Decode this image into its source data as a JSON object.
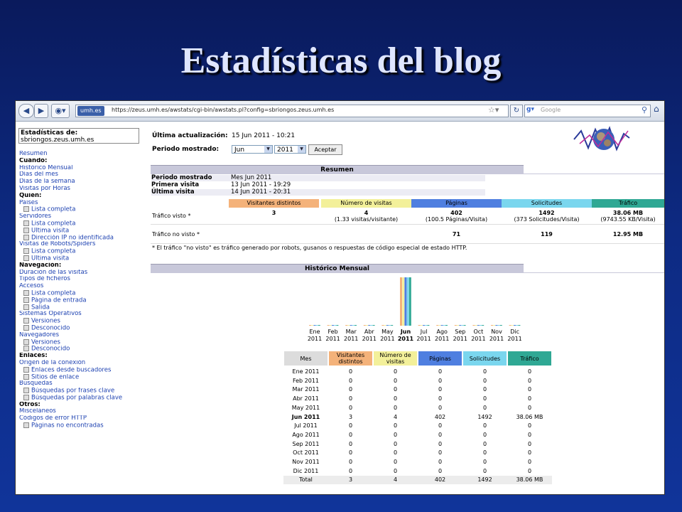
{
  "slide_title": "Estadísticas del blog",
  "browser": {
    "site_badge": "umh.es",
    "url": "https://zeus.umh.es/awstats/cgi-bin/awstats.pl?config=sbriongos.zeus.umh.es",
    "search_engine": "Google",
    "search_placeholder": "Google"
  },
  "sidebar": {
    "stats_label": "Estadísticas de:",
    "stats_site": "sbriongos.zeus.umh.es",
    "items": [
      {
        "type": "link",
        "label": "Resumen"
      },
      {
        "type": "head",
        "label": "Cuándo:"
      },
      {
        "type": "link",
        "label": "Histórico Mensual"
      },
      {
        "type": "link",
        "label": "Días del mes"
      },
      {
        "type": "link",
        "label": "Días de la semana"
      },
      {
        "type": "link",
        "label": "Visitas por Horas"
      },
      {
        "type": "head",
        "label": "Quién:"
      },
      {
        "type": "link",
        "label": "Países"
      },
      {
        "type": "sub",
        "label": "Lista completa"
      },
      {
        "type": "link",
        "label": "Servidores"
      },
      {
        "type": "sub",
        "label": "Lista completa"
      },
      {
        "type": "sub",
        "label": "Última visita"
      },
      {
        "type": "sub",
        "label": "Dirección IP no identificada"
      },
      {
        "type": "link",
        "label": "Visitas de Robots/Spiders"
      },
      {
        "type": "sub",
        "label": "Lista completa"
      },
      {
        "type": "sub",
        "label": "Última visita"
      },
      {
        "type": "head",
        "label": "Navegación:"
      },
      {
        "type": "link",
        "label": "Duración de las visitas"
      },
      {
        "type": "link",
        "label": "Tipos de ficheros"
      },
      {
        "type": "link",
        "label": "Accesos"
      },
      {
        "type": "sub",
        "label": "Lista completa"
      },
      {
        "type": "sub",
        "label": "Página de entrada"
      },
      {
        "type": "sub",
        "label": "Salida"
      },
      {
        "type": "link",
        "label": "Sistemas Operativos"
      },
      {
        "type": "sub",
        "label": "Versiones"
      },
      {
        "type": "sub",
        "label": "Desconocido"
      },
      {
        "type": "link",
        "label": "Navegadores"
      },
      {
        "type": "sub",
        "label": "Versiones"
      },
      {
        "type": "sub",
        "label": "Desconocido"
      },
      {
        "type": "head",
        "label": "Enlaces:"
      },
      {
        "type": "link",
        "label": "Origen de la conexión"
      },
      {
        "type": "sub",
        "label": "Enlaces desde buscadores"
      },
      {
        "type": "sub",
        "label": "Sitios de enlace"
      },
      {
        "type": "link",
        "label": "Búsquedas"
      },
      {
        "type": "sub",
        "label": "Búsquedas por frases clave"
      },
      {
        "type": "sub",
        "label": "Búsquedas por palabras clave"
      },
      {
        "type": "head",
        "label": "Otros:"
      },
      {
        "type": "link",
        "label": "Misceláneos"
      },
      {
        "type": "link",
        "label": "Códigos de error HTTP"
      },
      {
        "type": "sub",
        "label": "Páginas no encontradas"
      }
    ]
  },
  "header": {
    "last_update_label": "Última actualización:",
    "last_update_value": "15 Jun 2011 - 10:21",
    "period_label": "Periodo mostrado:",
    "month_select": "Jun",
    "year_select": "2011",
    "apply_label": "Aceptar"
  },
  "summary": {
    "title": "Resumen",
    "rows": [
      {
        "label": "Periodo mostrado",
        "value": "Mes Jun 2011"
      },
      {
        "label": "Primera visita",
        "value": "13 Jun 2011 - 19:29"
      },
      {
        "label": "Última visita",
        "value": "14 Jun 2011 - 20:31"
      }
    ],
    "columns": [
      "Visitantes distintos",
      "Número de visitas",
      "Páginas",
      "Solicitudes",
      "Tráfico"
    ],
    "column_colors": [
      "#f4b27a",
      "#f3f09a",
      "#4f7fe0",
      "#7ad6ee",
      "#2fa894"
    ],
    "seen_label": "Tráfico visto *",
    "seen": [
      [
        "3",
        ""
      ],
      [
        "4",
        "(1.33 visitas/visitante)"
      ],
      [
        "402",
        "(100.5 Páginas/Visita)"
      ],
      [
        "1492",
        "(373 Solicitudes/Visita)"
      ],
      [
        "38.06 MB",
        "(9743.55 KB/Visita)"
      ]
    ],
    "not_seen_label": "Tráfico no visto *",
    "not_seen": [
      "",
      "",
      "71",
      "119",
      "12.95 MB"
    ],
    "note": "* El tráfico \"no visto\" es tráfico generado por robots, gusanos o respuestas de código especial de estado HTTP."
  },
  "monthly": {
    "title": "Histórico Mensual",
    "headers": [
      "Mes",
      "Visitantes distintos",
      "Número de visitas",
      "Páginas",
      "Solicitudes",
      "Tráfico"
    ],
    "header_colors": [
      "#dcdcdc",
      "#f4b27a",
      "#f3f09a",
      "#4f7fe0",
      "#7ad6ee",
      "#2fa894"
    ],
    "rows": [
      [
        "Ene 2011",
        "0",
        "0",
        "0",
        "0",
        "0"
      ],
      [
        "Feb 2011",
        "0",
        "0",
        "0",
        "0",
        "0"
      ],
      [
        "Mar 2011",
        "0",
        "0",
        "0",
        "0",
        "0"
      ],
      [
        "Abr 2011",
        "0",
        "0",
        "0",
        "0",
        "0"
      ],
      [
        "May 2011",
        "0",
        "0",
        "0",
        "0",
        "0"
      ],
      [
        "Jun 2011",
        "3",
        "4",
        "402",
        "1492",
        "38.06 MB"
      ],
      [
        "Jul 2011",
        "0",
        "0",
        "0",
        "0",
        "0"
      ],
      [
        "Ago 2011",
        "0",
        "0",
        "0",
        "0",
        "0"
      ],
      [
        "Sep 2011",
        "0",
        "0",
        "0",
        "0",
        "0"
      ],
      [
        "Oct 2011",
        "0",
        "0",
        "0",
        "0",
        "0"
      ],
      [
        "Nov 2011",
        "0",
        "0",
        "0",
        "0",
        "0"
      ],
      [
        "Dic 2011",
        "0",
        "0",
        "0",
        "0",
        "0"
      ]
    ],
    "total": [
      "Total",
      "3",
      "4",
      "402",
      "1492",
      "38.06 MB"
    ]
  },
  "chart_data": {
    "type": "bar",
    "categories": [
      "Ene 2011",
      "Feb 2011",
      "Mar 2011",
      "Abr 2011",
      "May 2011",
      "Jun 2011",
      "Jul 2011",
      "Ago 2011",
      "Sep 2011",
      "Oct 2011",
      "Nov 2011",
      "Dic 2011"
    ],
    "cat_top": [
      "Ene",
      "Feb",
      "Mar",
      "Abr",
      "May",
      "Jun",
      "Jul",
      "Ago",
      "Sep",
      "Oct",
      "Nov",
      "Dic"
    ],
    "cat_bottom": [
      "2011",
      "2011",
      "2011",
      "2011",
      "2011",
      "2011",
      "2011",
      "2011",
      "2011",
      "2011",
      "2011",
      "2011"
    ],
    "highlight_index": 5,
    "series": [
      {
        "values": [
          0,
          0,
          0,
          0,
          0,
          3,
          0,
          0,
          0,
          0,
          0,
          0
        ],
        "color": "#f4b27a"
      },
      {
        "values": [
          0,
          0,
          0,
          0,
          0,
          4,
          0,
          0,
          0,
          0,
          0,
          0
        ],
        "color": "#f3f09a"
      },
      {
        "values": [
          0,
          0,
          0,
          0,
          0,
          402,
          0,
          0,
          0,
          0,
          0,
          0
        ],
        "color": "#4f7fe0"
      },
      {
        "values": [
          0,
          0,
          0,
          0,
          0,
          1492,
          0,
          0,
          0,
          0,
          0,
          0
        ],
        "color": "#7ad6ee"
      },
      {
        "values": [
          0,
          0,
          0,
          0,
          0,
          38.06,
          0,
          0,
          0,
          0,
          0,
          0
        ],
        "color": "#2fa894"
      }
    ]
  }
}
